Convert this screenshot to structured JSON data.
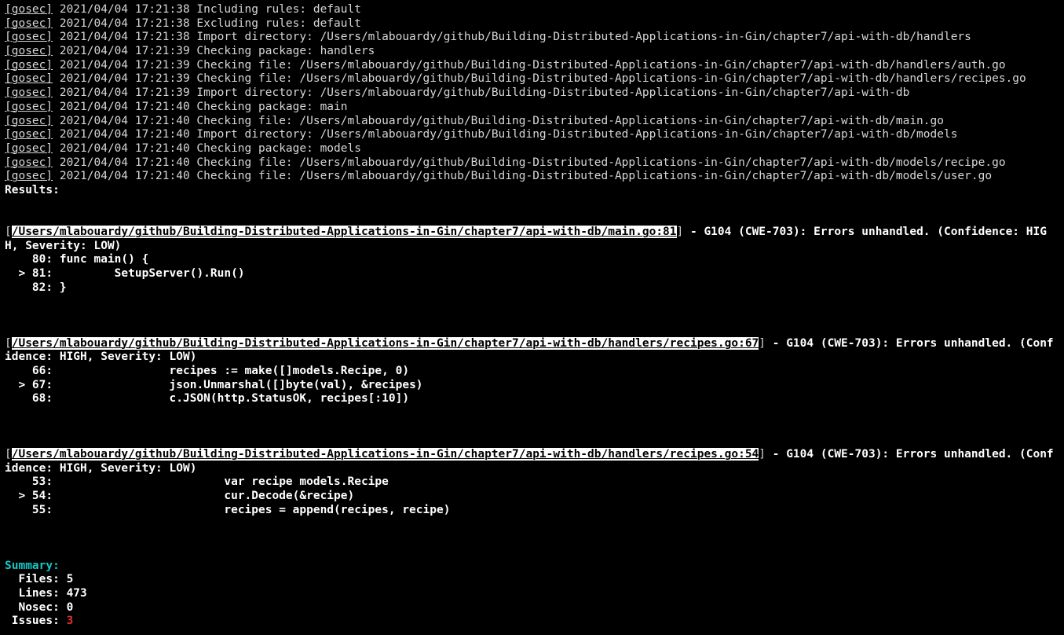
{
  "tool_tag": "[gosec]",
  "log_lines": [
    {
      "ts": "2021/04/04 17:21:38",
      "msg": "Including rules: default"
    },
    {
      "ts": "2021/04/04 17:21:38",
      "msg": "Excluding rules: default"
    },
    {
      "ts": "2021/04/04 17:21:38",
      "msg": "Import directory: /Users/mlabouardy/github/Building-Distributed-Applications-in-Gin/chapter7/api-with-db/handlers"
    },
    {
      "ts": "2021/04/04 17:21:39",
      "msg": "Checking package: handlers"
    },
    {
      "ts": "2021/04/04 17:21:39",
      "msg": "Checking file: /Users/mlabouardy/github/Building-Distributed-Applications-in-Gin/chapter7/api-with-db/handlers/auth.go"
    },
    {
      "ts": "2021/04/04 17:21:39",
      "msg": "Checking file: /Users/mlabouardy/github/Building-Distributed-Applications-in-Gin/chapter7/api-with-db/handlers/recipes.go"
    },
    {
      "ts": "2021/04/04 17:21:39",
      "msg": "Import directory: /Users/mlabouardy/github/Building-Distributed-Applications-in-Gin/chapter7/api-with-db"
    },
    {
      "ts": "2021/04/04 17:21:40",
      "msg": "Checking package: main"
    },
    {
      "ts": "2021/04/04 17:21:40",
      "msg": "Checking file: /Users/mlabouardy/github/Building-Distributed-Applications-in-Gin/chapter7/api-with-db/main.go"
    },
    {
      "ts": "2021/04/04 17:21:40",
      "msg": "Import directory: /Users/mlabouardy/github/Building-Distributed-Applications-in-Gin/chapter7/api-with-db/models"
    },
    {
      "ts": "2021/04/04 17:21:40",
      "msg": "Checking package: models"
    },
    {
      "ts": "2021/04/04 17:21:40",
      "msg": "Checking file: /Users/mlabouardy/github/Building-Distributed-Applications-in-Gin/chapter7/api-with-db/models/recipe.go"
    },
    {
      "ts": "2021/04/04 17:21:40",
      "msg": "Checking file: /Users/mlabouardy/github/Building-Distributed-Applications-in-Gin/chapter7/api-with-db/models/user.go"
    }
  ],
  "results_label": "Results:",
  "findings": [
    {
      "path": "/Users/mlabouardy/github/Building-Distributed-Applications-in-Gin/chapter7/api-with-db/main.go:81",
      "desc": " - G104 (CWE-703): Errors unhandled. (Confidence: HIGH, Severity: LOW)",
      "code": [
        "    80: func main() {",
        "  > 81:         SetupServer().Run()",
        "    82: }"
      ]
    },
    {
      "path": "/Users/mlabouardy/github/Building-Distributed-Applications-in-Gin/chapter7/api-with-db/handlers/recipes.go:67",
      "desc": " - G104 (CWE-703): Errors unhandled. (Confidence: HIGH, Severity: LOW)",
      "code": [
        "    66:                 recipes := make([]models.Recipe, 0)",
        "  > 67:                 json.Unmarshal([]byte(val), &recipes)",
        "    68:                 c.JSON(http.StatusOK, recipes[:10])"
      ]
    },
    {
      "path": "/Users/mlabouardy/github/Building-Distributed-Applications-in-Gin/chapter7/api-with-db/handlers/recipes.go:54",
      "desc": " - G104 (CWE-703): Errors unhandled. (Confidence: HIGH, Severity: LOW)",
      "code": [
        "    53:                         var recipe models.Recipe",
        "  > 54:                         cur.Decode(&recipe)",
        "    55:                         recipes = append(recipes, recipe)"
      ]
    }
  ],
  "summary": {
    "title": "Summary:",
    "rows": [
      {
        "label": "  Files: ",
        "value": "5"
      },
      {
        "label": "  Lines: ",
        "value": "473"
      },
      {
        "label": "  Nosec: ",
        "value": "0"
      }
    ],
    "issues_label": " Issues: ",
    "issues_value": "3"
  }
}
